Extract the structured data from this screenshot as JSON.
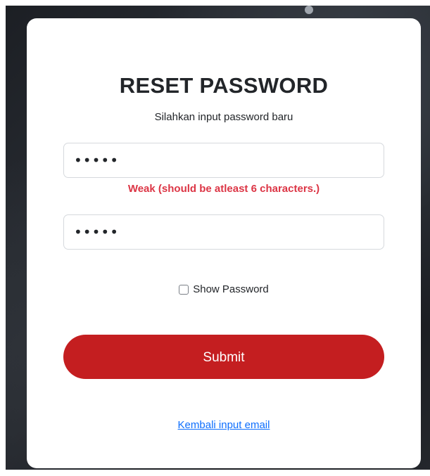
{
  "card": {
    "title": "RESET PASSWORD",
    "subtitle": "Silahkan input password baru"
  },
  "form": {
    "password": {
      "value": "•••••"
    },
    "confirm_password": {
      "value": "•••••"
    },
    "strength_error": "Weak (should be atleast 6 characters.)",
    "show_password_label": "Show Password",
    "show_password_checked": false,
    "submit_label": "Submit"
  },
  "footer": {
    "back_link_label": "Kembali input email"
  },
  "colors": {
    "primary_button": "#c41e20",
    "error_text": "#dc3545",
    "link": "#0d6efd"
  }
}
